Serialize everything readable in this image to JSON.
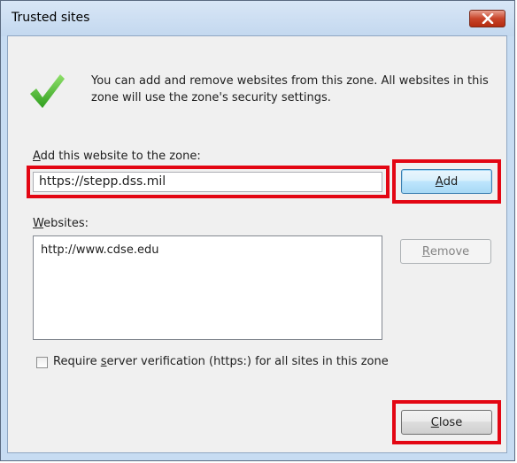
{
  "window": {
    "title": "Trusted sites"
  },
  "info": {
    "text": "You can add and remove websites from this zone. All websites in this zone will use the zone's security settings."
  },
  "add_section": {
    "label_access": "A",
    "label_rest": "dd this website to the zone:",
    "input_value": "https://stepp.dss.mil",
    "add_button_access": "A",
    "add_button_rest": "dd"
  },
  "websites_section": {
    "label_access": "W",
    "label_rest": "ebsites:",
    "items": [
      "http://www.cdse.edu"
    ],
    "remove_button_access": "R",
    "remove_button_rest": "emove"
  },
  "verification": {
    "label_pre": "Require ",
    "label_access": "s",
    "label_post": "erver verification (https:) for all sites in this zone",
    "checked": false
  },
  "footer": {
    "close_access": "C",
    "close_rest": "lose"
  },
  "colors": {
    "highlight": "#e30613",
    "checkmark": "#4caf2a"
  }
}
